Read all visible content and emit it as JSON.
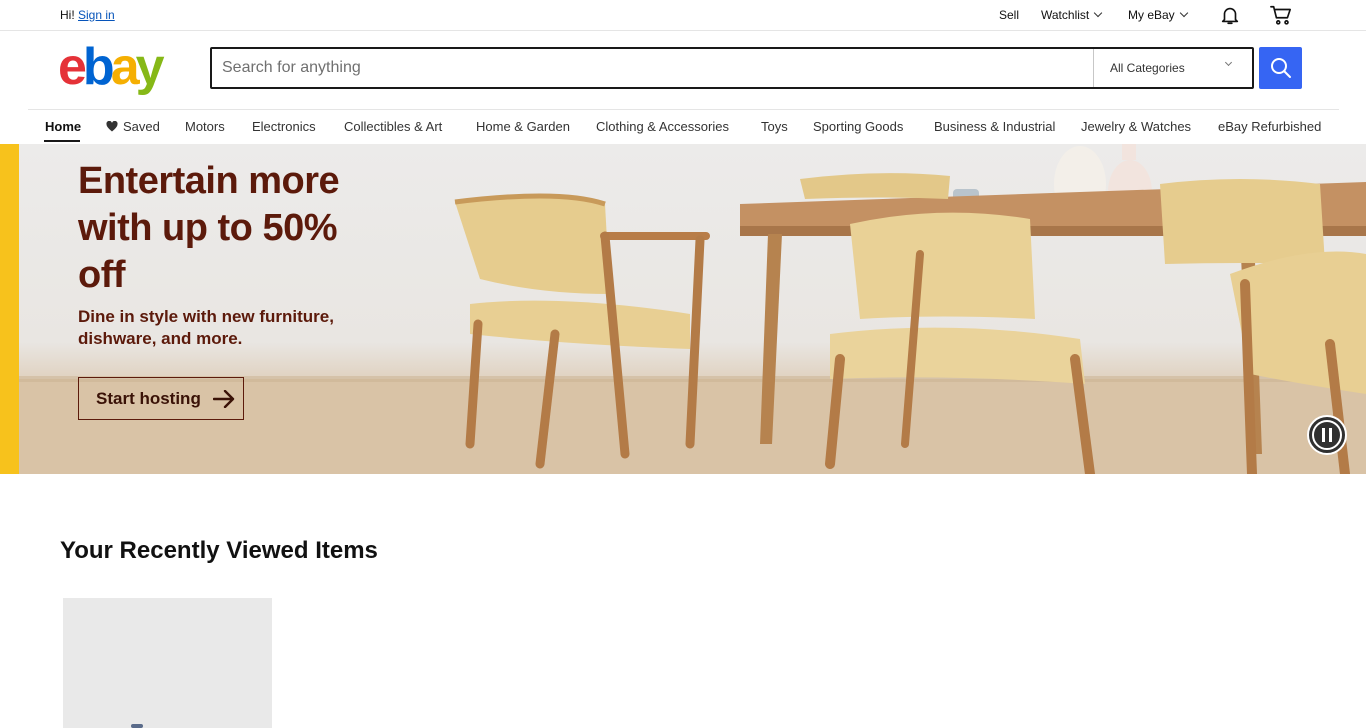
{
  "header": {
    "greeting_prefix": "Hi!",
    "sign_in": "Sign in",
    "sell": "Sell",
    "watchlist": "Watchlist",
    "my_ebay": "My eBay",
    "icons": {
      "notifications": "bell-icon",
      "cart": "cart-icon"
    }
  },
  "logo": {
    "letters": [
      "e",
      "b",
      "a",
      "y"
    ],
    "colors": [
      "#e53238",
      "#0064d2",
      "#f5af02",
      "#86b817"
    ]
  },
  "search": {
    "placeholder": "Search for anything",
    "category": "All Categories",
    "button_icon": "search-icon",
    "button_color": "#3665f3"
  },
  "categories": [
    {
      "label": "Home",
      "active": true
    },
    {
      "label": "Saved",
      "icon": "heart-icon"
    },
    {
      "label": "Motors"
    },
    {
      "label": "Electronics"
    },
    {
      "label": "Collectibles & Art"
    },
    {
      "label": "Home & Garden"
    },
    {
      "label": "Clothing & Accessories"
    },
    {
      "label": "Toys"
    },
    {
      "label": "Sporting Goods"
    },
    {
      "label": "Business & Industrial"
    },
    {
      "label": "Jewelry & Watches"
    },
    {
      "label": "eBay Refurbished"
    }
  ],
  "hero": {
    "title": "Entertain more with up to 50% off",
    "subtitle": "Dine in style with new furniture, dishware, and more.",
    "cta": "Start hosting",
    "accent_color": "#f7c21c",
    "text_color": "#5c1a0b",
    "pause_icon": "pause-icon"
  },
  "recently_viewed": {
    "title": "Your Recently Viewed Items"
  }
}
